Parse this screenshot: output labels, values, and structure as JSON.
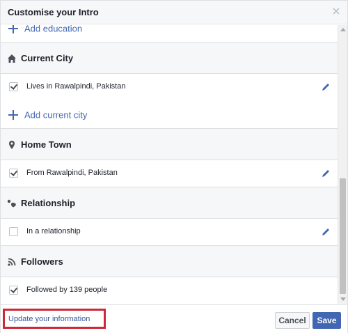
{
  "dialog": {
    "title": "Customise your Intro"
  },
  "education": {
    "add_label": "Add education"
  },
  "current_city": {
    "title": "Current City",
    "item_text": "Lives in Rawalpindi, Pakistan",
    "item_checked": true,
    "add_label": "Add current city"
  },
  "home_town": {
    "title": "Home Town",
    "item_text": "From Rawalpindi, Pakistan",
    "item_checked": true
  },
  "relationship": {
    "title": "Relationship",
    "item_text": "In a relationship",
    "item_checked": false
  },
  "followers": {
    "title": "Followers",
    "item_text": "Followed by 139 people",
    "item_checked": true
  },
  "footer": {
    "update_link": "Update your information",
    "cancel_label": "Cancel",
    "save_label": "Save"
  },
  "colors": {
    "accent": "#4267b2",
    "highlight_border": "#cc2936",
    "section_background": "#f6f7f9"
  },
  "icons": {
    "close": "close-icon",
    "plus": "plus-icon",
    "home": "home-icon",
    "location": "location-pin-icon",
    "relationship": "relationship-icon",
    "rss": "rss-icon",
    "edit": "pencil-icon"
  }
}
